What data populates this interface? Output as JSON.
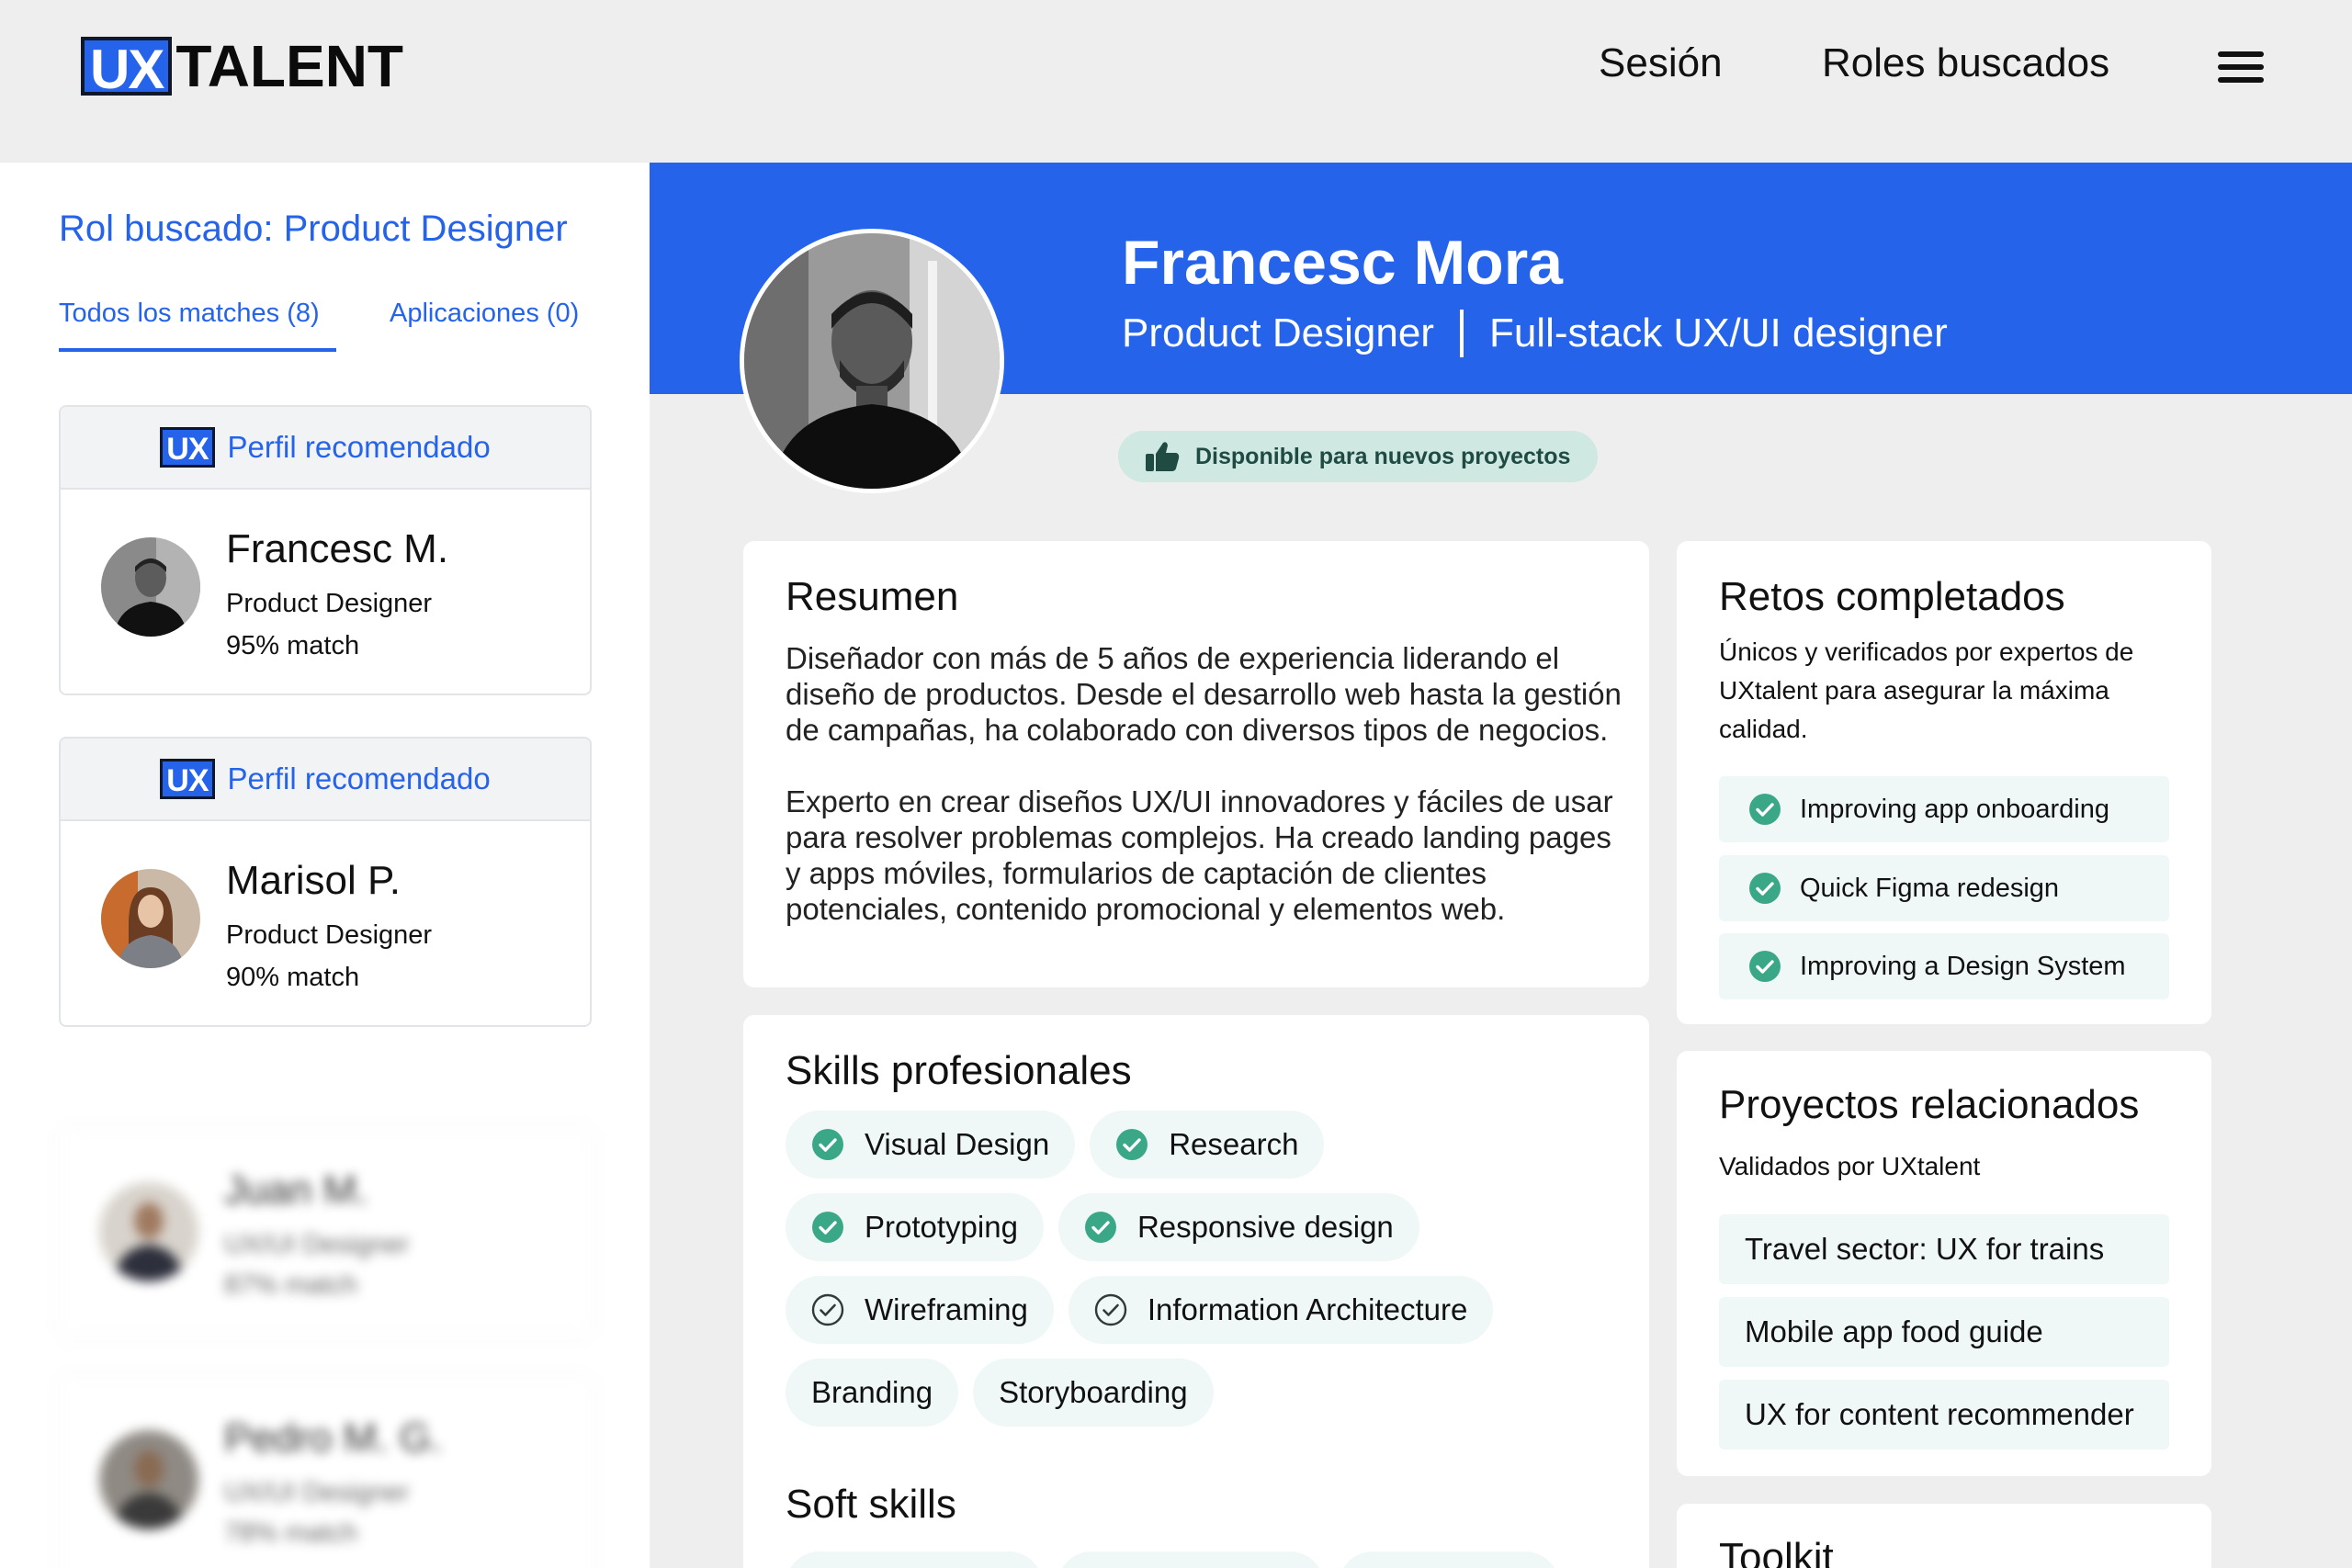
{
  "header": {
    "logo_ux": "UX",
    "logo_talent": "TALENT",
    "nav": [
      {
        "label": "Sesión"
      },
      {
        "label": "Roles buscados"
      }
    ],
    "menu_icon": "hamburger-menu-icon"
  },
  "sidebar": {
    "role_title": "Rol buscado: Product Designer",
    "tabs": [
      {
        "label": "Todos los matches (8)",
        "active": true
      },
      {
        "label": "Aplicaciones (0)",
        "active": false
      }
    ],
    "recommended_badge": "UX",
    "recommended_label": "Perfil recomendado",
    "matches": [
      {
        "name": "Francesc M.",
        "role": "Product Designer",
        "match": "95% match",
        "recommended": true
      },
      {
        "name": "Marisol P.",
        "role": "Product Designer",
        "match": "90% match",
        "recommended": true
      },
      {
        "name": "Juan M.",
        "role": "UX/UI Designer",
        "match": "87% match",
        "recommended": false
      },
      {
        "name": "Pedro M. G.",
        "role": "UX/UI Designer",
        "match": "78% match",
        "recommended": false
      }
    ]
  },
  "profile": {
    "name": "Francesc Mora",
    "title": "Product Designer",
    "subtitle": "Full-stack UX/UI designer",
    "availability": "Disponible para nuevos proyectos",
    "summary": {
      "title": "Resumen",
      "paragraphs": [
        "Diseñador con más de 5 años de experiencia liderando el diseño de productos. Desde el desarrollo web hasta la gestión de campañas, ha colaborado con diversos tipos de negocios.",
        "Experto en crear diseños UX/UI innovadores y fáciles de usar para resolver problemas complejos. Ha creado landing pages y apps móviles, formularios de captación de clientes potenciales, contenido promocional y elementos web."
      ]
    },
    "skills": {
      "title": "Skills profesionales",
      "rows": [
        [
          {
            "label": "Visual Design",
            "check": "filled"
          },
          {
            "label": "Research",
            "check": "filled"
          }
        ],
        [
          {
            "label": "Prototyping",
            "check": "filled"
          },
          {
            "label": "Responsive design",
            "check": "filled"
          }
        ],
        [
          {
            "label": "Wireframing",
            "check": "outline"
          },
          {
            "label": "Information Architecture",
            "check": "outline"
          }
        ],
        [
          {
            "label": "Branding",
            "check": "none"
          },
          {
            "label": "Storyboarding",
            "check": "none"
          }
        ]
      ],
      "soft_title": "Soft skills"
    },
    "challenges": {
      "title": "Retos completados",
      "description": "Únicos y verificados por expertos de UXtalent para asegurar la máxima calidad.",
      "items": [
        "Improving app onboarding",
        "Quick Figma redesign",
        "Improving a Design System"
      ]
    },
    "projects": {
      "title": "Proyectos relacionados",
      "subtitle": "Validados por UXtalent",
      "items": [
        "Travel sector: UX for trains",
        "Mobile app food guide",
        "UX for content recommender"
      ]
    },
    "toolkit_title": "Toolkit"
  },
  "colors": {
    "brand_blue": "#2563eb",
    "check_green": "#3aa886",
    "chip_bg": "#f0f7f7",
    "avail_bg": "#cfe8e1"
  }
}
